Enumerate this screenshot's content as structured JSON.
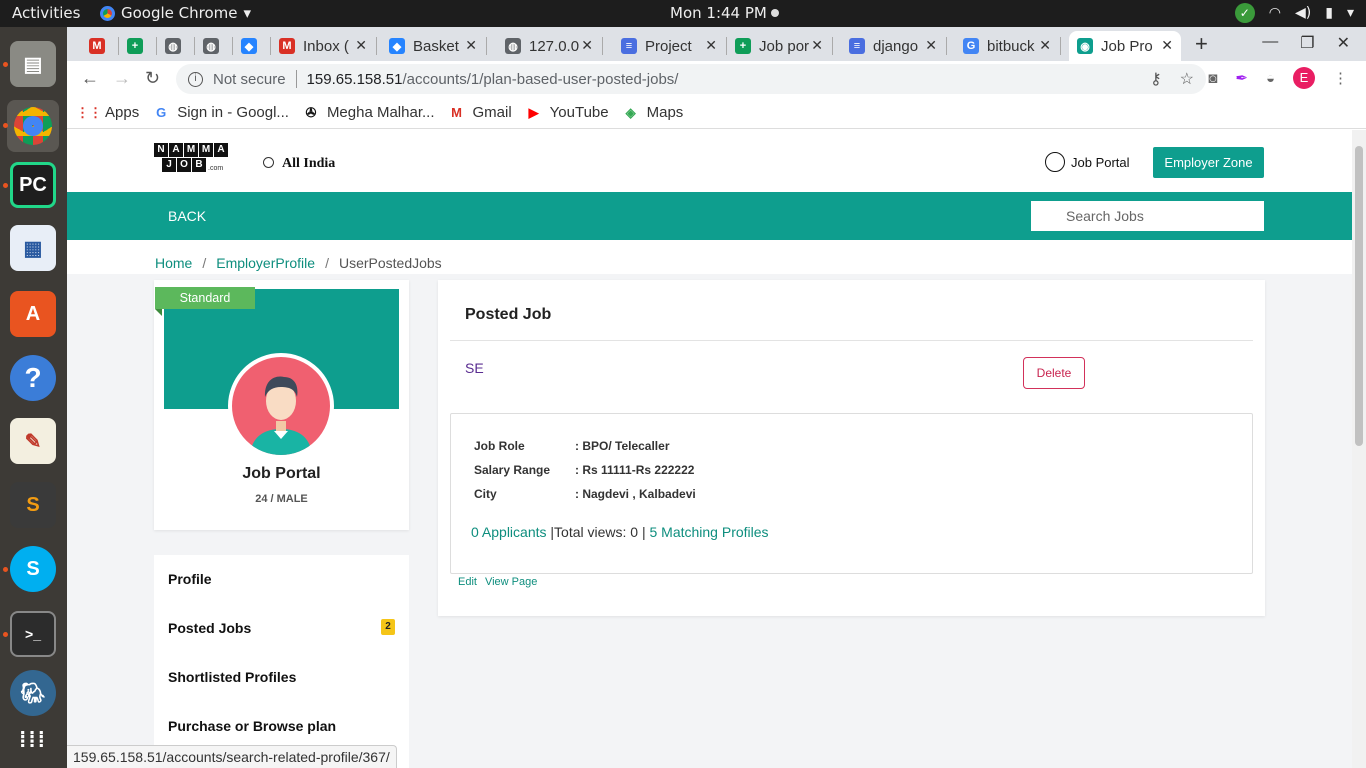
{
  "os": {
    "activities": "Activities",
    "app_name": "Google Chrome",
    "clock": "Mon  1:44 PM"
  },
  "tabs": [
    {
      "label": "",
      "icon": "gmail-icon",
      "color": "#d93025",
      "glyph": "M"
    },
    {
      "label": "",
      "icon": "sheets-icon",
      "color": "#0f9d58",
      "glyph": "+"
    },
    {
      "label": "",
      "icon": "globe-icon",
      "color": "#5f6368",
      "glyph": "◍"
    },
    {
      "label": "",
      "icon": "globe-icon",
      "color": "#5f6368",
      "glyph": "◍"
    },
    {
      "label": "",
      "icon": "bitbucket-icon",
      "color": "#2684ff",
      "glyph": "◆"
    },
    {
      "label": "Inbox (",
      "icon": "gmail-icon",
      "color": "#d93025",
      "glyph": "M"
    },
    {
      "label": "Basket",
      "icon": "bitbucket-icon",
      "color": "#2684ff",
      "glyph": "◆"
    },
    {
      "label": "127.0.0",
      "icon": "globe-icon",
      "color": "#5f6368",
      "glyph": "◍"
    },
    {
      "label": "Project",
      "icon": "docs-icon",
      "color": "#4a6ee0",
      "glyph": "≡"
    },
    {
      "label": "Job por",
      "icon": "sheets-icon",
      "color": "#0f9d58",
      "glyph": "+"
    },
    {
      "label": "django",
      "icon": "docs-icon",
      "color": "#4a6ee0",
      "glyph": "≡"
    },
    {
      "label": "bitbuck",
      "icon": "google-icon",
      "color": "#4285f4",
      "glyph": "G"
    },
    {
      "label": "Job Pro",
      "icon": "jobportal-icon",
      "color": "#0e9e8e",
      "glyph": "◉"
    }
  ],
  "url": {
    "security": "Not secure",
    "host": "159.65.158.51",
    "path": "/accounts/1/plan-based-user-posted-jobs/"
  },
  "profile_initial": "E",
  "bookmarks": [
    {
      "label": "Apps",
      "icon": "apps-grid-icon",
      "glyph": "⋮⋮",
      "color": "#d93025"
    },
    {
      "label": "Sign in - Googl...",
      "icon": "google-icon",
      "glyph": "G",
      "color": "#4285f4"
    },
    {
      "label": "Megha Malhar...",
      "icon": "film-reel-icon",
      "glyph": "✇",
      "color": "#111"
    },
    {
      "label": "Gmail",
      "icon": "gmail-icon",
      "glyph": "M",
      "color": "#d93025"
    },
    {
      "label": "YouTube",
      "icon": "youtube-icon",
      "glyph": "▶",
      "color": "#ff0000"
    },
    {
      "label": "Maps",
      "icon": "maps-icon",
      "glyph": "◈",
      "color": "#34a853"
    }
  ],
  "site": {
    "logo_top": [
      "N",
      "A",
      "M",
      "M",
      "A"
    ],
    "logo_bottom": [
      "J",
      "O",
      "B"
    ],
    "logo_suffix": ".com",
    "location": "All  India",
    "job_portal_link": "Job Portal",
    "employer_zone": "Employer Zone",
    "back": "BACK",
    "search_placeholder": "Search Jobs",
    "accent": "#0e9e8e"
  },
  "breadcrumb": {
    "home": "Home",
    "employer_profile": "EmployerProfile",
    "current": "UserPostedJobs"
  },
  "profile": {
    "plan_badge": "Standard",
    "name": "Job Portal",
    "meta": "24 / MALE"
  },
  "menu": {
    "profile": "Profile",
    "posted_jobs": "Posted Jobs",
    "posted_jobs_count": "2",
    "shortlisted": "Shortlisted Profiles",
    "purchase": "Purchase or Browse plan"
  },
  "posted_job": {
    "heading": "Posted Job",
    "title": "SE",
    "delete": "Delete",
    "details": {
      "role_label": "Job Role",
      "role_value": ": BPO/ Telecaller",
      "salary_label": "Salary Range",
      "salary_value": ": Rs 11111-Rs 222222",
      "city_label": "City",
      "city_value": ": Nagdevi , Kalbadevi"
    },
    "applicants": "0 Applicants",
    "views": "|Total views: 0 |",
    "matching": "5 Matching Profiles",
    "edit": "Edit",
    "view_page": "View Page"
  },
  "status_url": "159.65.158.51/accounts/search-related-profile/367/"
}
